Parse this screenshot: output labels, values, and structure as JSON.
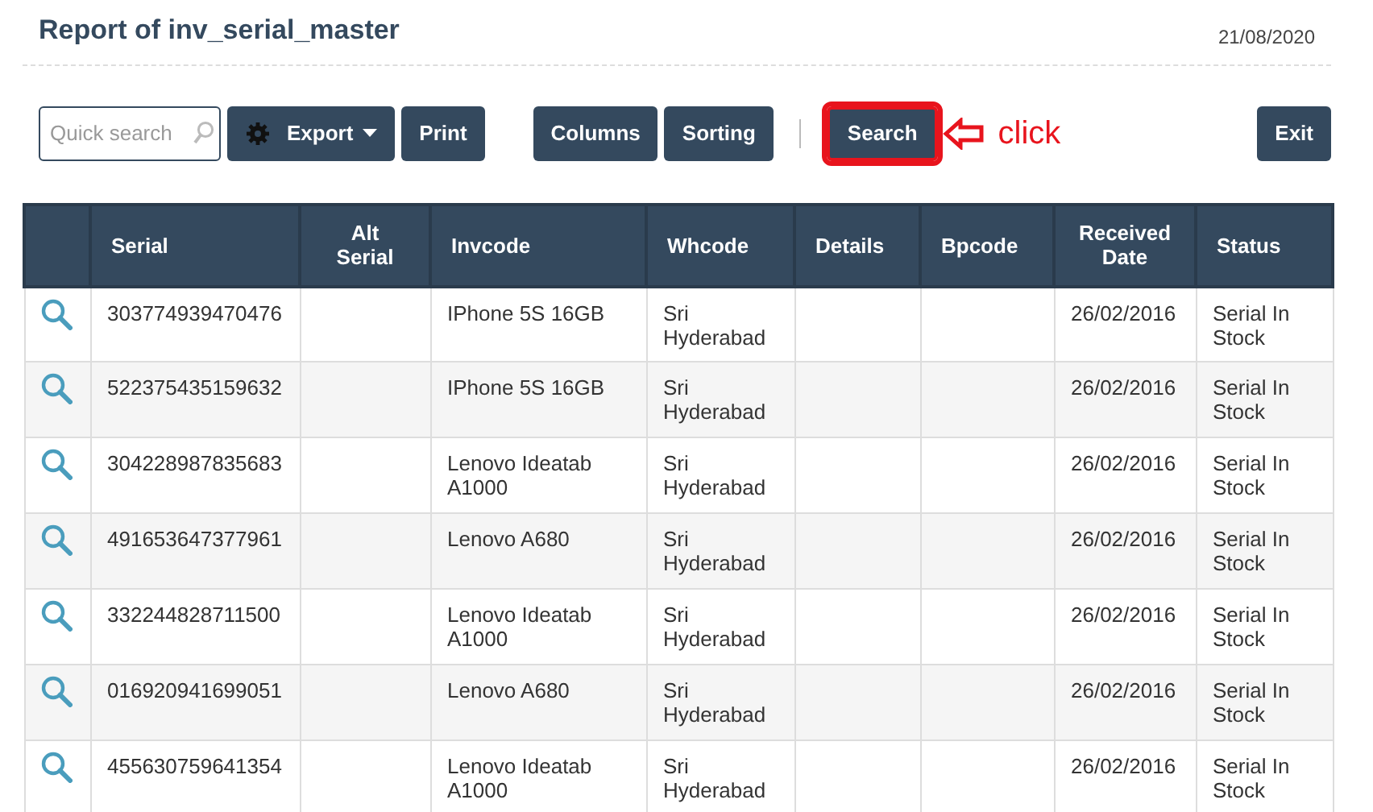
{
  "header": {
    "title": "Report of inv_serial_master",
    "date": "21/08/2020"
  },
  "toolbar": {
    "search": {
      "placeholder": "Quick search"
    },
    "button_groups": [
      [
        {
          "label": "Export",
          "kind": "menu",
          "highlighted": false
        },
        {
          "label": "Print",
          "kind": "plain",
          "highlighted": false
        }
      ],
      [
        {
          "label": "Columns",
          "kind": "plain",
          "highlighted": false
        },
        {
          "label": "Sorting",
          "kind": "plain",
          "highlighted": false
        }
      ],
      [
        {
          "label": "Search",
          "kind": "plain",
          "highlighted": true
        }
      ],
      [
        {
          "label": "Exit",
          "kind": "plain",
          "highlighted": false
        }
      ]
    ],
    "annotation": {
      "text": "click"
    }
  },
  "table": {
    "columns": [
      "Serial",
      "Alt Serial",
      "Invcode",
      "Whcode",
      "Details",
      "Bpcode",
      "Received Date",
      "Status"
    ],
    "rows": [
      [
        "303774939470476",
        "",
        "IPhone 5S 16GB",
        "Sri Hyderabad",
        "",
        "",
        "26/02/2016",
        "Serial In Stock"
      ],
      [
        "522375435159632",
        "",
        "IPhone 5S 16GB",
        "Sri Hyderabad",
        "",
        "",
        "26/02/2016",
        "Serial In Stock"
      ],
      [
        "304228987835683",
        "",
        "Lenovo Ideatab A1000",
        "Sri Hyderabad",
        "",
        "",
        "26/02/2016",
        "Serial In Stock"
      ],
      [
        "491653647377961",
        "",
        "Lenovo A680",
        "Sri Hyderabad",
        "",
        "",
        "26/02/2016",
        "Serial In Stock"
      ],
      [
        "332244828711500",
        "",
        "Lenovo Ideatab A1000",
        "Sri Hyderabad",
        "",
        "",
        "26/02/2016",
        "Serial In Stock"
      ],
      [
        "016920941699051",
        "",
        "Lenovo A680",
        "Sri Hyderabad",
        "",
        "",
        "26/02/2016",
        "Serial In Stock"
      ],
      [
        "455630759641354",
        "",
        "Lenovo Ideatab A1000",
        "Sri Hyderabad",
        "",
        "",
        "26/02/2016",
        "Serial In Stock"
      ]
    ]
  }
}
